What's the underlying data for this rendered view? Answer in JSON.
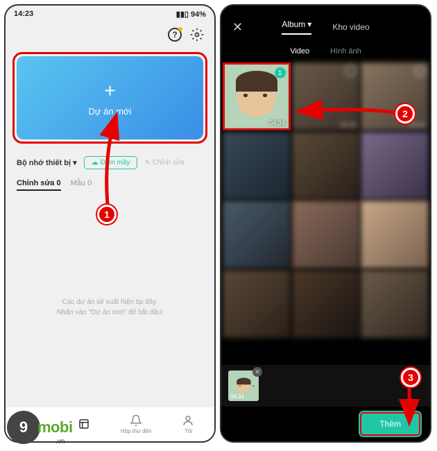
{
  "status": {
    "time": "14:23",
    "battery": "94%"
  },
  "topicons": {
    "help": "?",
    "settings": "gear"
  },
  "newproject": {
    "label": "Dự án mới"
  },
  "storage": {
    "label": "Bộ nhớ thiết bị",
    "cloud": "Đám mây",
    "edit": "Chỉnh sửa"
  },
  "small_tabs": {
    "edit": "Chỉnh sửa",
    "edit_count": "0",
    "template": "Mẫu",
    "template_count": "0"
  },
  "empty_msg": {
    "line1": "Các dự án sẽ xuất hiện tại đây.",
    "line2": "Nhấn vào \"Dự án mới\" để bắt đầu!"
  },
  "bottomnav": {
    "edit": "",
    "template": "",
    "inbox": "Hộp thư đến",
    "me": "Tôi"
  },
  "picker": {
    "tabs_top": {
      "album": "Album",
      "stock": "Kho video"
    },
    "subtabs": {
      "video": "Video",
      "image": "Hình ảnh"
    },
    "thumbs": [
      {
        "dur": "04:34",
        "selected": "1"
      },
      {
        "dur": "00:15"
      },
      {
        "dur": "00:15"
      }
    ],
    "tray_dur": "04:34",
    "add_btn": "Thêm"
  },
  "markers": {
    "m1": "1",
    "m2": "2",
    "m3": "3"
  },
  "watermark": {
    "nine": "9",
    "mobi": "mobi",
    "vn": ".vn"
  }
}
